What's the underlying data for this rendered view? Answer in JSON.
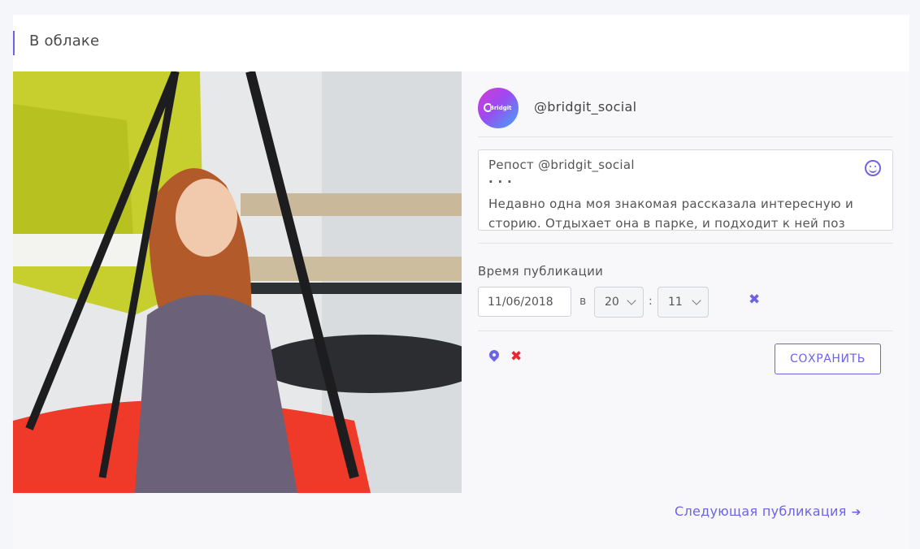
{
  "header": {
    "title": "В облаке"
  },
  "post": {
    "avatar_text": "Bridgit",
    "username": "@bridgit_social",
    "caption_lines": [
      "Репост @bridgit_social",
      "  .  .  .",
      "Недавно одна моя знакомая рассказала интересную и",
      "сторию. Отдыхает она в парке, и подходит к ней поз"
    ],
    "emoji_icon": "smiley-icon"
  },
  "schedule": {
    "label": "Время публикации",
    "date_value": "11/06/2018",
    "at_label": "в",
    "hour_value": "20",
    "colon": ":",
    "minute_value": "11",
    "clear_icon": "✖"
  },
  "actions": {
    "location_icon": "map-pin-icon",
    "clear_location_icon": "✖",
    "save_label": "СОХРАНИТЬ"
  },
  "footer": {
    "next_label": "Следующая публикация",
    "next_arrow": "➔"
  },
  "colors": {
    "accent": "#6c63e6",
    "danger": "#e8262e"
  }
}
